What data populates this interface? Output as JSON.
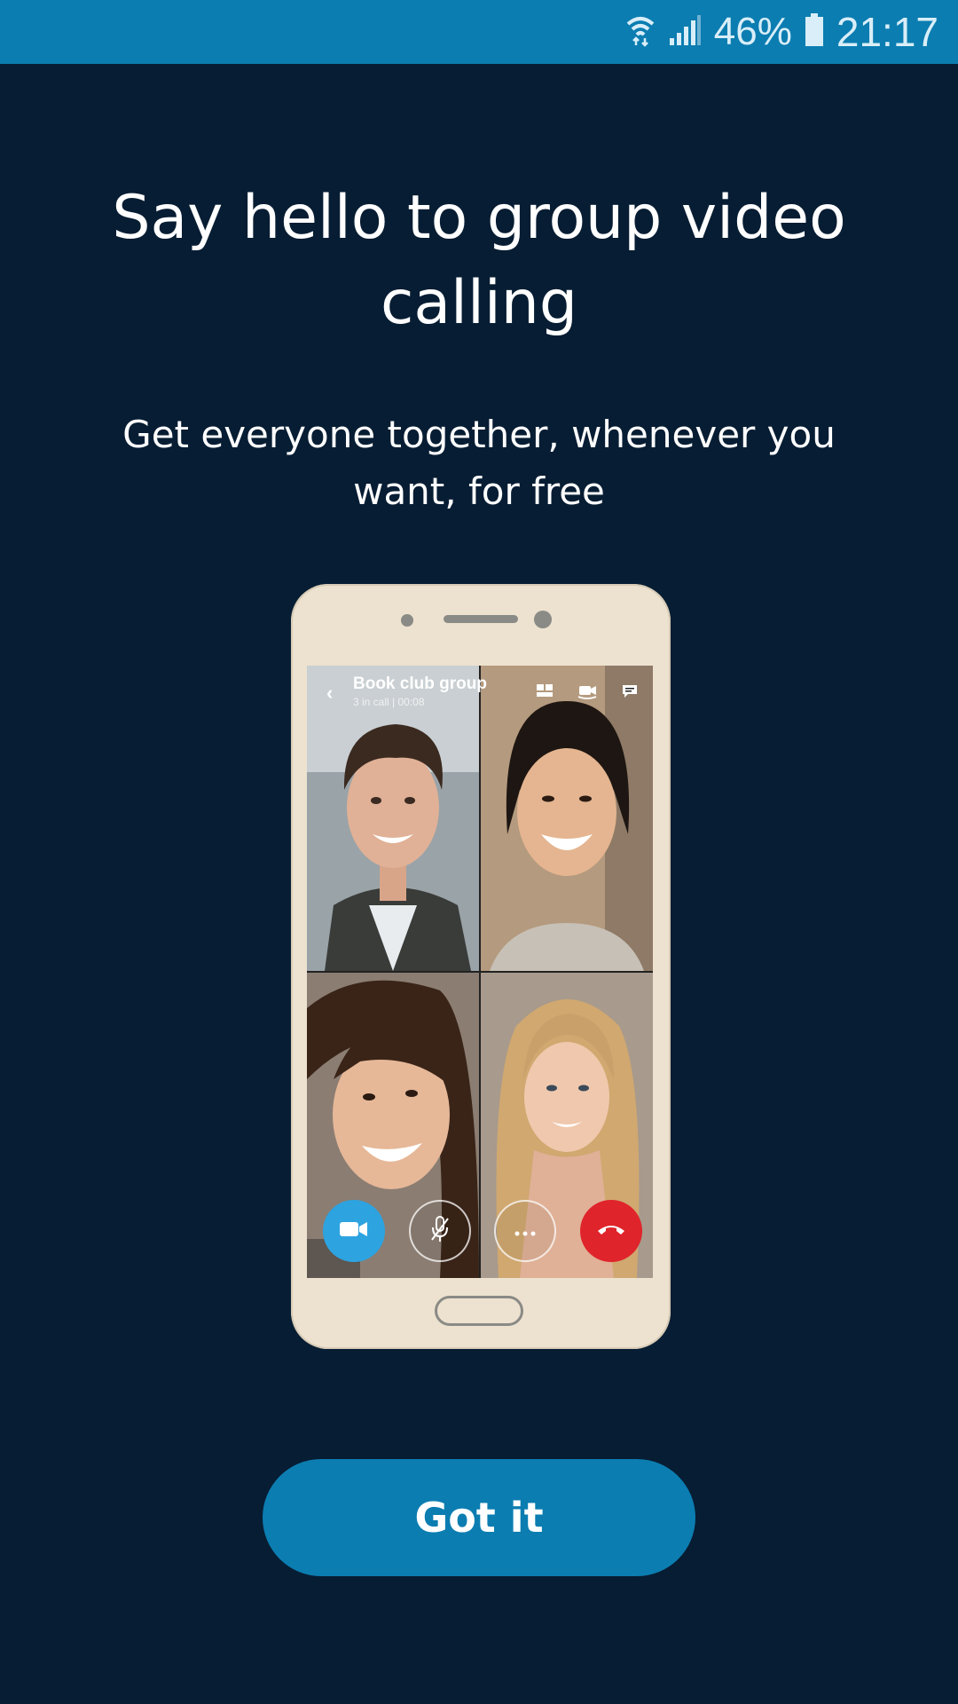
{
  "status_bar": {
    "battery_percent": "46%",
    "time": "21:17",
    "icons": [
      "wifi-icon",
      "signal-icon",
      "battery-icon"
    ]
  },
  "headline": "Say hello to group video calling",
  "subhead": "Get everyone together, whenever you want, for free",
  "illustration": {
    "call_title": "Book club group",
    "call_subtitle": "3 in call | 00:08",
    "top_icons": [
      "participants-icon",
      "switch-camera-icon",
      "chat-icon"
    ],
    "controls": [
      "video-icon",
      "mute-icon",
      "more-icon",
      "end-call-icon"
    ]
  },
  "primary_button": "Got it",
  "colors": {
    "background": "#071d33",
    "accent": "#0b7db1",
    "video_button": "#2da3e0",
    "end_call": "#e0242b",
    "phone_body": "#ede2cf"
  }
}
